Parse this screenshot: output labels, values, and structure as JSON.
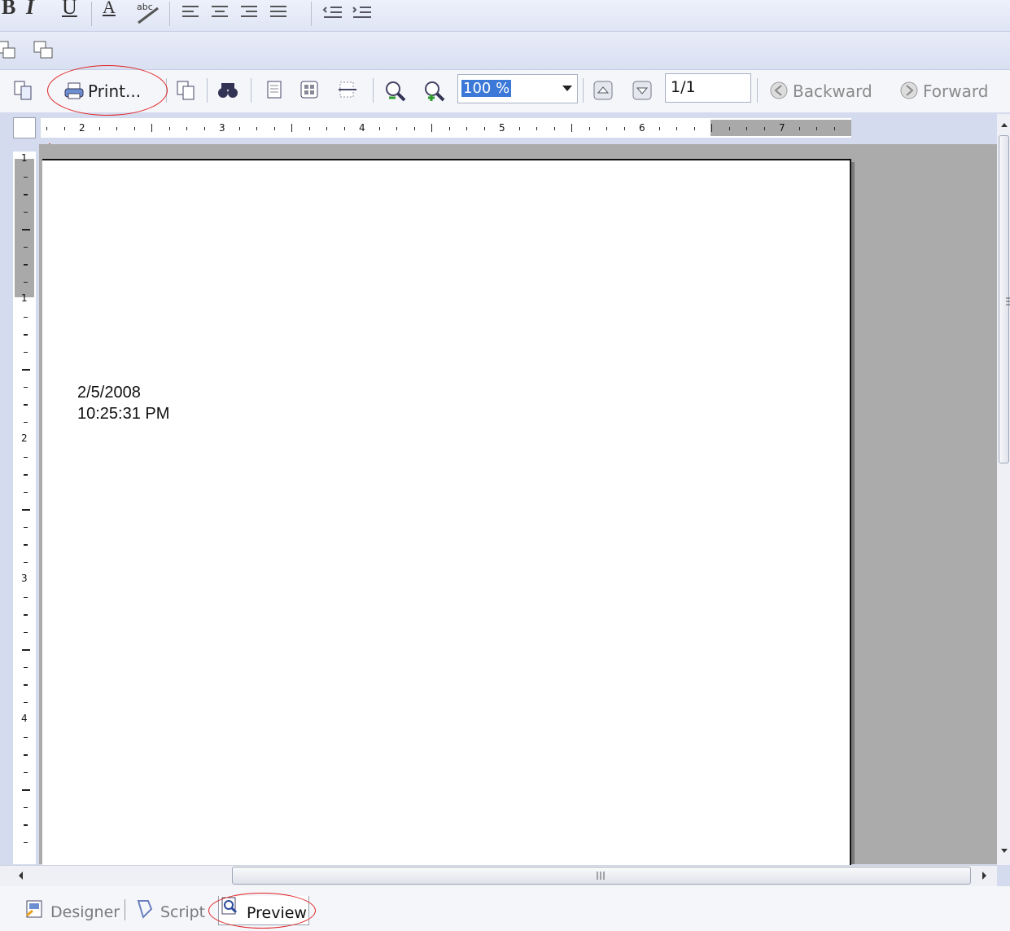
{
  "formatting_toolbar": {
    "items": [
      "bold-icon",
      "italic-icon",
      "underline-icon",
      "font-color-icon",
      "spellcheck-icon",
      "align-left-icon",
      "align-center-icon",
      "align-right-icon",
      "justify-icon",
      "decrease-indent-icon",
      "increase-indent-icon"
    ]
  },
  "preview_toolbar": {
    "print_label": "Print...",
    "zoom_value": "100 %",
    "page_value": "1/1",
    "backward_label": "Backward",
    "forward_label": "Forward"
  },
  "ruler": {
    "horizontal_numbers": [
      "2",
      "3",
      "4",
      "5",
      "6",
      "7"
    ],
    "vertical_numbers": [
      "1",
      "1",
      "2",
      "3",
      "4"
    ]
  },
  "report": {
    "date": "2/5/2008",
    "time": "10:25:31 PM"
  },
  "tabs": {
    "designer": "Designer",
    "script": "Script",
    "preview": "Preview"
  },
  "colors": {
    "annotation": "#e02020",
    "selection": "#3b78d8",
    "workspace": "#ababab"
  }
}
